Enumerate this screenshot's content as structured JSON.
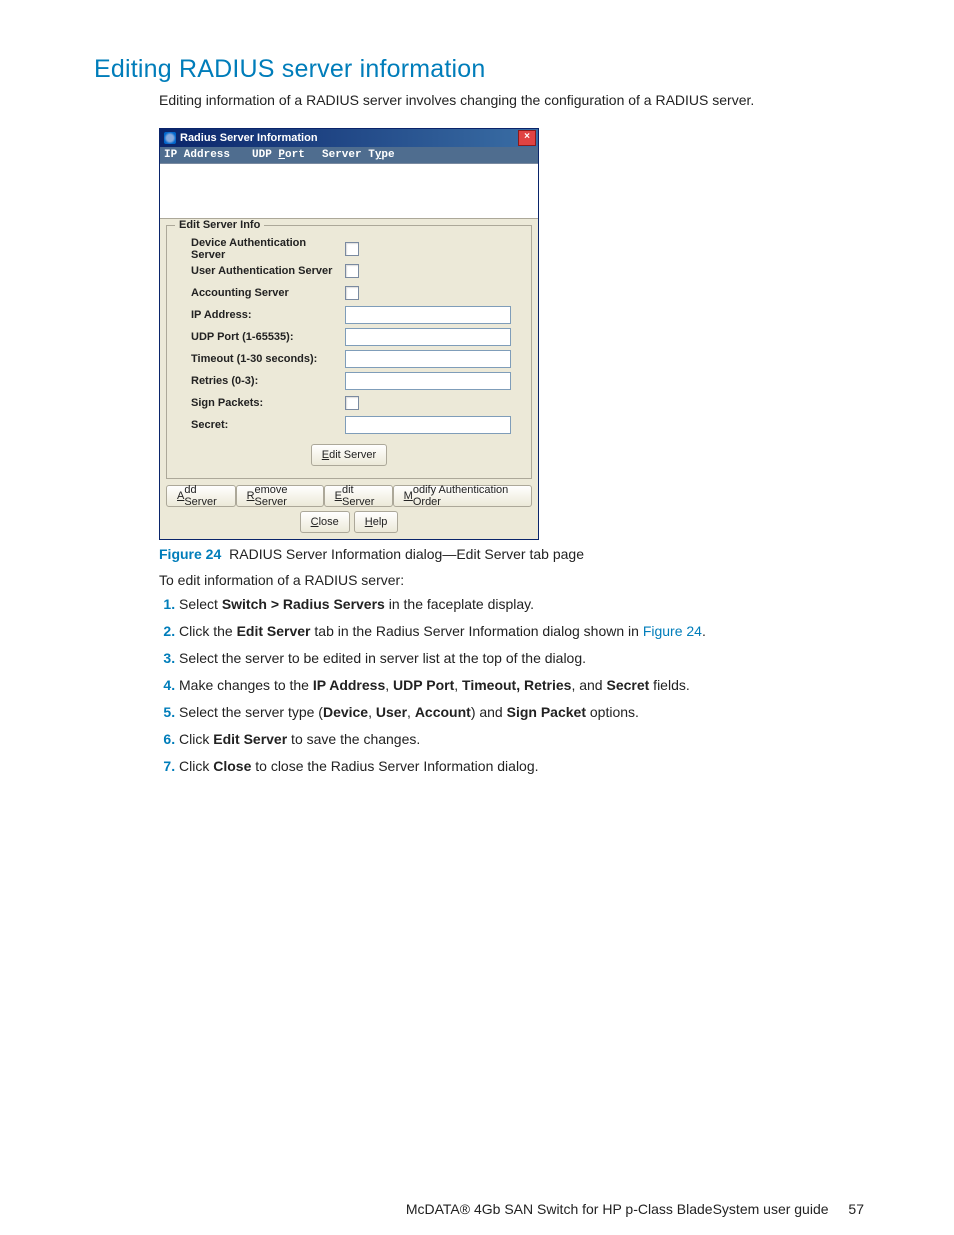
{
  "heading": "Editing RADIUS server information",
  "intro": "Editing information of a RADIUS server involves changing the configuration of a RADIUS server.",
  "dialog": {
    "title": "Radius Server Information",
    "close_glyph": "×",
    "columns": {
      "ip": "IP Address",
      "port_prefix": "UDP ",
      "port_ul": "P",
      "port_suffix": "ort",
      "type_prefix": "Server T",
      "type_ul": "y",
      "type_suffix": "pe"
    },
    "legend": "Edit Server Info",
    "rows": {
      "dev_auth": "Device Authentication Server",
      "user_auth": "User Authentication Server",
      "acct": "Accounting Server",
      "ip": "IP Address:",
      "udp": "UDP Port (1-65535):",
      "timeout": "Timeout (1-30 seconds):",
      "retries": "Retries (0-3):",
      "sign": "Sign Packets:",
      "secret": "Secret:"
    },
    "center_btn_ul": "E",
    "center_btn_rest": "dit Server",
    "tabs": {
      "add_ul": "A",
      "add_rest": "dd Server",
      "remove_ul": "R",
      "remove_rest": "emove Server",
      "edit_ul": "E",
      "edit_rest": "dit Server",
      "modify_ul": "M",
      "modify_rest": "odify Authentication Order"
    },
    "bottom": {
      "close_ul": "C",
      "close_rest": "lose",
      "help_ul": "H",
      "help_rest": "elp"
    }
  },
  "caption_label": "Figure 24",
  "caption_text": "RADIUS Server Information dialog—Edit Server tab page",
  "lead": "To edit information of a RADIUS server:",
  "steps": {
    "s1_a": "Select ",
    "s1_b": "Switch > Radius Servers",
    "s1_c": " in the faceplate display.",
    "s2_a": "Click the ",
    "s2_b": "Edit Server",
    "s2_c": " tab in the Radius Server Information dialog shown in ",
    "s2_link": "Figure 24",
    "s2_d": ".",
    "s3": "Select the server to be edited in server list at the top of the dialog.",
    "s4_a": "Make changes to the ",
    "s4_b": "IP Address",
    "s4_c": ", ",
    "s4_d": "UDP Port",
    "s4_e": ", ",
    "s4_f": "Timeout, Retries",
    "s4_g": ", and ",
    "s4_h": "Secret",
    "s4_i": " fields.",
    "s5_a": "Select the server type (",
    "s5_b": "Device",
    "s5_c": ", ",
    "s5_d": "User",
    "s5_e": ", ",
    "s5_f": "Account",
    "s5_g": ") and ",
    "s5_h": "Sign Packet",
    "s5_i": " options.",
    "s6_a": "Click ",
    "s6_b": "Edit Server",
    "s6_c": " to save the changes.",
    "s7_a": "Click ",
    "s7_b": "Close",
    "s7_c": " to close the Radius Server Information dialog."
  },
  "footer": {
    "doc": "McDATA® 4Gb SAN Switch for HP p-Class BladeSystem user guide",
    "page": "57"
  }
}
